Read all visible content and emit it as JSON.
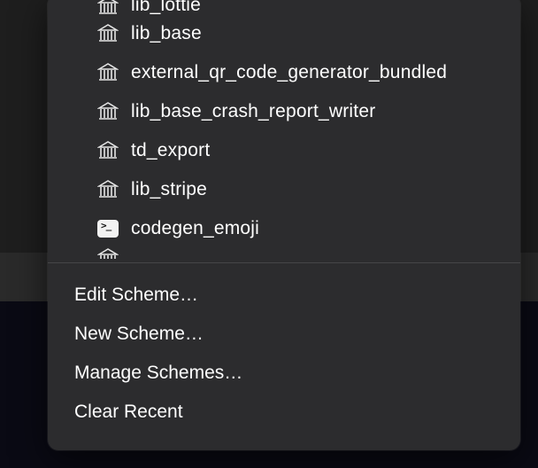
{
  "schemes": [
    {
      "icon": "library",
      "label": "lib_lottie"
    },
    {
      "icon": "library",
      "label": "lib_base"
    },
    {
      "icon": "library",
      "label": "external_qr_code_generator_bundled"
    },
    {
      "icon": "library",
      "label": "lib_base_crash_report_writer"
    },
    {
      "icon": "library",
      "label": "td_export"
    },
    {
      "icon": "library",
      "label": "lib_stripe"
    },
    {
      "icon": "terminal",
      "label": "codegen_emoji"
    }
  ],
  "peek_scheme": {
    "icon": "library",
    "label": ""
  },
  "actions": {
    "edit": "Edit Scheme…",
    "new": "New Scheme…",
    "manage": "Manage Schemes…",
    "clear_recent": "Clear Recent"
  }
}
